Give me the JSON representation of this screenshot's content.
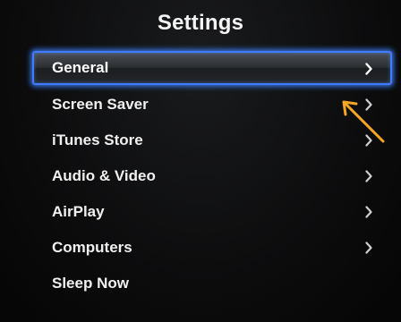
{
  "screen": {
    "title": "Settings"
  },
  "menu": {
    "items": [
      {
        "label": "General",
        "selected": true,
        "has_chevron": true
      },
      {
        "label": "Screen Saver",
        "selected": false,
        "has_chevron": true
      },
      {
        "label": "iTunes Store",
        "selected": false,
        "has_chevron": true
      },
      {
        "label": "Audio & Video",
        "selected": false,
        "has_chevron": true
      },
      {
        "label": "AirPlay",
        "selected": false,
        "has_chevron": true
      },
      {
        "label": "Computers",
        "selected": false,
        "has_chevron": true
      },
      {
        "label": "Sleep Now",
        "selected": false,
        "has_chevron": false
      }
    ]
  },
  "colors": {
    "selection_border": "#3f7cff",
    "annotation_arrow": "#f5a623",
    "chevron": "#d8d8d8"
  },
  "icons": {
    "chevron": "chevron-right-icon",
    "annotation": "annotation-arrow-icon"
  }
}
